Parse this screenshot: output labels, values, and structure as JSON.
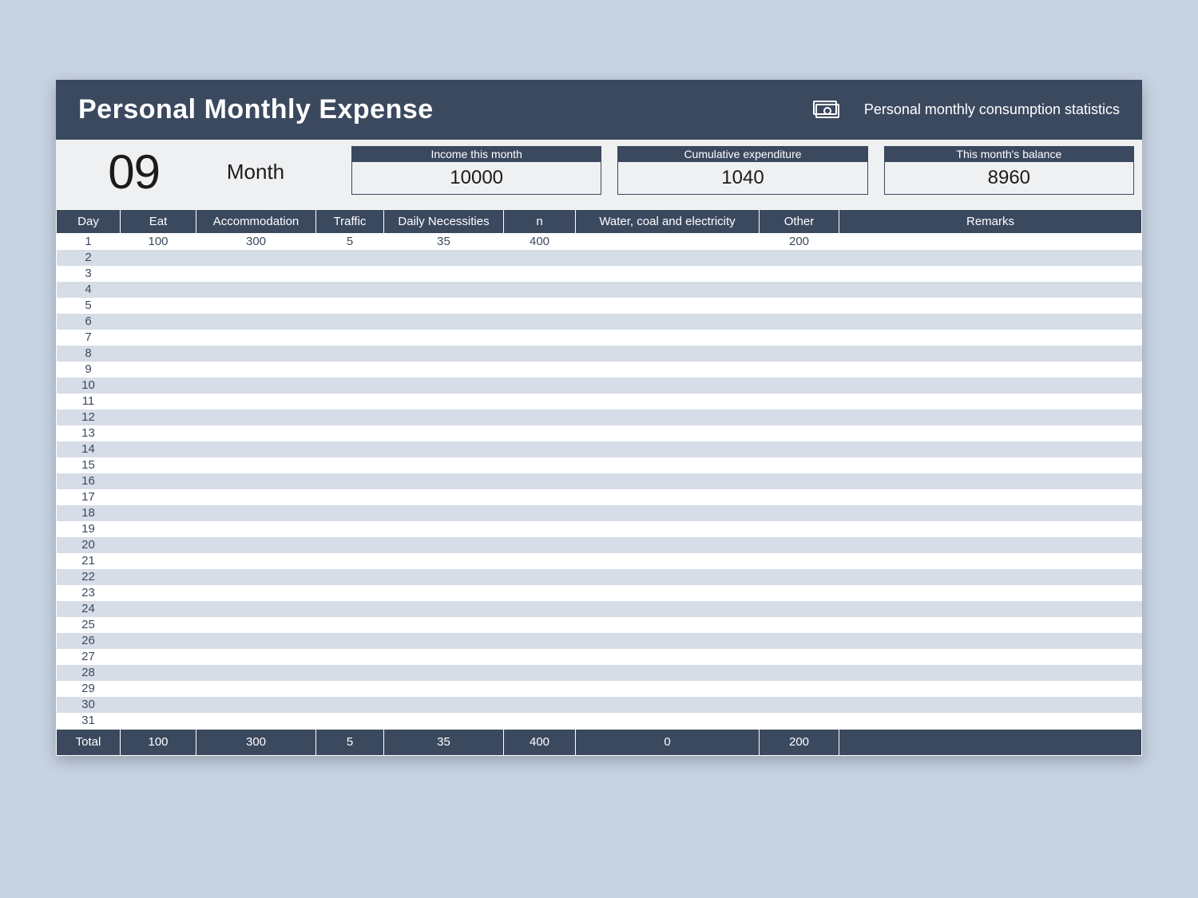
{
  "header": {
    "title": "Personal Monthly Expense",
    "subtitle": "Personal monthly consumption statistics"
  },
  "summary": {
    "month_number": "09",
    "month_label": "Month",
    "metrics": [
      {
        "label": "Income this month",
        "value": "10000"
      },
      {
        "label": "Cumulative expenditure",
        "value": "1040"
      },
      {
        "label": "This month's balance",
        "value": "8960"
      }
    ]
  },
  "table": {
    "columns": [
      "Day",
      "Eat",
      "Accommodation",
      "Traffic",
      "Daily Necessities",
      "n",
      "Water, coal and electricity",
      "Other",
      "Remarks"
    ],
    "rows": [
      {
        "day": "1",
        "eat": "100",
        "accom": "300",
        "traffic": "5",
        "necess": "35",
        "n": "400",
        "util": "",
        "other": "200",
        "remarks": ""
      },
      {
        "day": "2"
      },
      {
        "day": "3"
      },
      {
        "day": "4"
      },
      {
        "day": "5"
      },
      {
        "day": "6"
      },
      {
        "day": "7"
      },
      {
        "day": "8"
      },
      {
        "day": "9"
      },
      {
        "day": "10"
      },
      {
        "day": "11"
      },
      {
        "day": "12"
      },
      {
        "day": "13"
      },
      {
        "day": "14"
      },
      {
        "day": "15"
      },
      {
        "day": "16"
      },
      {
        "day": "17"
      },
      {
        "day": "18"
      },
      {
        "day": "19"
      },
      {
        "day": "20"
      },
      {
        "day": "21"
      },
      {
        "day": "22"
      },
      {
        "day": "23"
      },
      {
        "day": "24"
      },
      {
        "day": "25"
      },
      {
        "day": "26"
      },
      {
        "day": "27"
      },
      {
        "day": "28"
      },
      {
        "day": "29"
      },
      {
        "day": "30"
      },
      {
        "day": "31"
      }
    ],
    "totals": {
      "label": "Total",
      "eat": "100",
      "accom": "300",
      "traffic": "5",
      "necess": "35",
      "n": "400",
      "util": "0",
      "other": "200",
      "remarks": ""
    }
  }
}
